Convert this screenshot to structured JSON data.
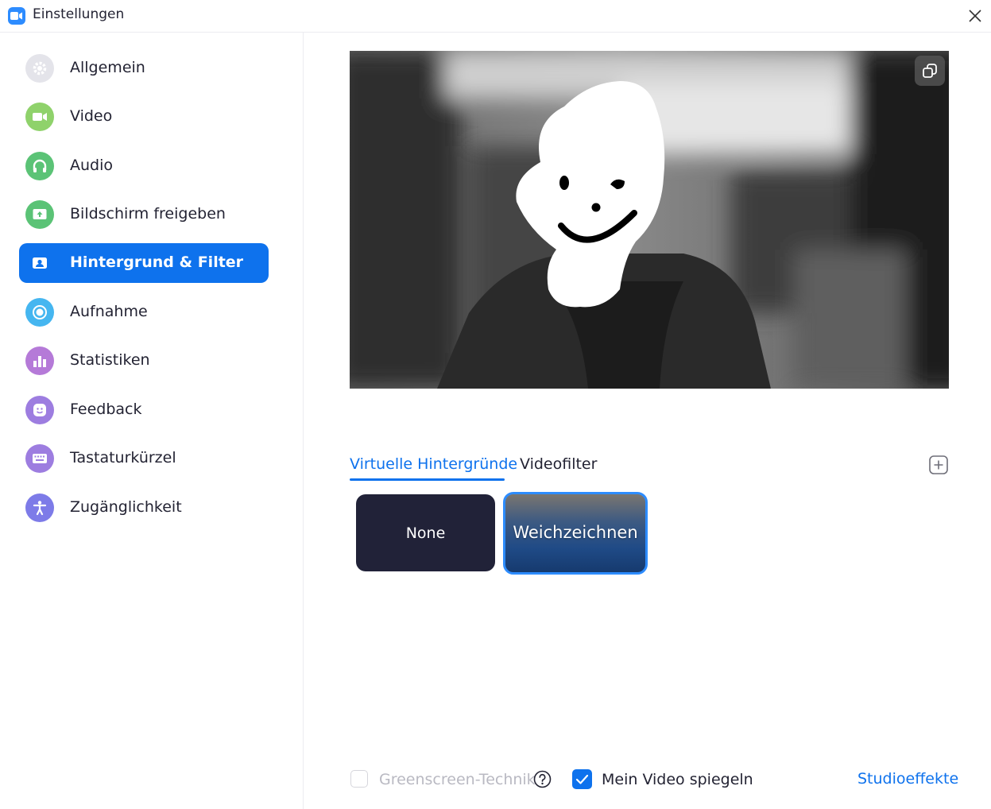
{
  "window": {
    "title": "Einstellungen",
    "app_icon": "video-camera-icon",
    "close_icon": "close-icon"
  },
  "sidebar": {
    "items": [
      {
        "label": "Allgemein",
        "icon": "gear-icon",
        "color": "#e0e0e6",
        "active": false
      },
      {
        "label": "Video",
        "icon": "video-camera-icon",
        "color": "#8fd26b",
        "active": false
      },
      {
        "label": "Audio",
        "icon": "headphones-icon",
        "color": "#5bc376",
        "active": false
      },
      {
        "label": "Bildschirm freigeben",
        "icon": "share-screen-icon",
        "color": "#5bc376",
        "active": false
      },
      {
        "label": "Hintergrund & Filter",
        "icon": "person-card-icon",
        "color": "#0e72ed",
        "active": true
      },
      {
        "label": "Aufnahme",
        "icon": "record-icon",
        "color": "#45b6f0",
        "active": false
      },
      {
        "label": "Statistiken",
        "icon": "bar-chart-icon",
        "color": "#b57ad8",
        "active": false
      },
      {
        "label": "Feedback",
        "icon": "smiley-icon",
        "color": "#9d7de0",
        "active": false
      },
      {
        "label": "Tastaturkürzel",
        "icon": "keyboard-icon",
        "color": "#9d7de0",
        "active": false
      },
      {
        "label": "Zugänglichkeit",
        "icon": "accessibility-icon",
        "color": "#7d7be8",
        "active": false
      }
    ]
  },
  "preview": {
    "rotate_icon": "rotate-camera-icon"
  },
  "tabs": [
    {
      "label": "Virtuelle Hintergründe",
      "active": true
    },
    {
      "label": "Videofilter",
      "active": false
    }
  ],
  "add_icon": "plus-icon",
  "backgrounds": [
    {
      "label": "None",
      "selected": false
    },
    {
      "label": "Weichzeichnen",
      "selected": true
    }
  ],
  "options": {
    "greenscreen": {
      "label": "Greenscreen-Technik",
      "checked": false,
      "disabled": true
    },
    "help_icon": "question-icon",
    "mirror": {
      "label": "Mein Video spiegeln",
      "checked": true
    },
    "studio_link": "Studioeffekte"
  },
  "colors": {
    "accent": "#0e72ed",
    "tile_dark": "#212238"
  }
}
